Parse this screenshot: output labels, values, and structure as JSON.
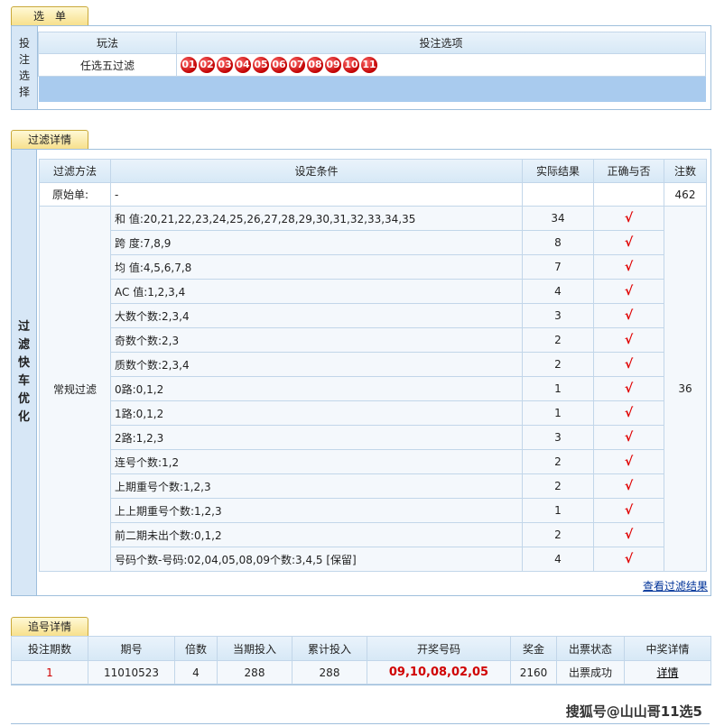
{
  "section1": {
    "tab": "选　单",
    "side_label": [
      "投",
      "注",
      "选",
      "择"
    ],
    "col_playtype": "玩法",
    "col_options": "投注选项",
    "play_type": "任选五过滤",
    "balls": [
      "01",
      "02",
      "03",
      "04",
      "05",
      "06",
      "07",
      "08",
      "09",
      "10",
      "11"
    ]
  },
  "section2": {
    "tab": "过滤详情",
    "side_label": [
      "过",
      "滤",
      "快",
      "车",
      "优",
      "化"
    ],
    "headers": {
      "method": "过滤方法",
      "condition": "设定条件",
      "result": "实际结果",
      "correct": "正确与否",
      "count": "注数"
    },
    "original": {
      "label": "原始单:",
      "condition": "-",
      "count": "462"
    },
    "group_label": "常规过滤",
    "group_count": "36",
    "check": "√",
    "rows": [
      {
        "condition": "和 值:20,21,22,23,24,25,26,27,28,29,30,31,32,33,34,35",
        "result": "34"
      },
      {
        "condition": "跨 度:7,8,9",
        "result": "8"
      },
      {
        "condition": "均 值:4,5,6,7,8",
        "result": "7"
      },
      {
        "condition": "AC 值:1,2,3,4",
        "result": "4"
      },
      {
        "condition": "大数个数:2,3,4",
        "result": "3"
      },
      {
        "condition": "奇数个数:2,3",
        "result": "2"
      },
      {
        "condition": "质数个数:2,3,4",
        "result": "2"
      },
      {
        "condition": "0路:0,1,2",
        "result": "1"
      },
      {
        "condition": "1路:0,1,2",
        "result": "1"
      },
      {
        "condition": "2路:1,2,3",
        "result": "3"
      },
      {
        "condition": "连号个数:1,2",
        "result": "2"
      },
      {
        "condition": "上期重号个数:1,2,3",
        "result": "2"
      },
      {
        "condition": "上上期重号个数:1,2,3",
        "result": "1"
      },
      {
        "condition": "前二期未出个数:0,1,2",
        "result": "2"
      },
      {
        "condition": "号码个数-号码:02,04,05,08,09个数:3,4,5 [保留]",
        "result": "4"
      }
    ],
    "view_link": "查看过滤结果"
  },
  "section3": {
    "tab": "追号详情",
    "headers": [
      "投注期数",
      "期号",
      "倍数",
      "当期投入",
      "累计投入",
      "开奖号码",
      "奖金",
      "出票状态",
      "中奖详情"
    ],
    "row": [
      "1",
      "11010523",
      "4",
      "288",
      "288",
      "09,10,08,02,05",
      "2160",
      "出票成功",
      "详情"
    ]
  },
  "watermark": "搜狐号@山山哥11选5"
}
